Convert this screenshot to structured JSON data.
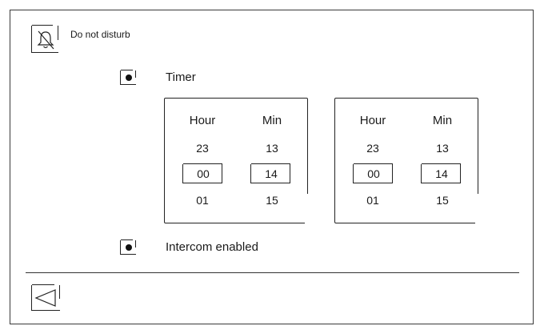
{
  "header": {
    "icon": "bell-off-icon",
    "label": "Do not disturb"
  },
  "options": {
    "timer": {
      "label": "Timer",
      "selected": true
    },
    "intercom": {
      "label": "Intercom enabled",
      "selected": true
    }
  },
  "timers": [
    {
      "hour_label": "Hour",
      "min_label": "Min",
      "hour_prev": "23",
      "hour_value": "00",
      "hour_next": "01",
      "min_prev": "13",
      "min_value": "14",
      "min_next": "15"
    },
    {
      "hour_label": "Hour",
      "min_label": "Min",
      "hour_prev": "23",
      "hour_value": "00",
      "hour_next": "01",
      "min_prev": "13",
      "min_value": "14",
      "min_next": "15"
    }
  ],
  "footer": {
    "back_icon": "back-triangle-icon"
  }
}
